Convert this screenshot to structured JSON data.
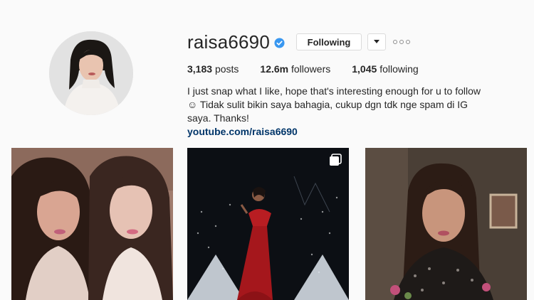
{
  "profile": {
    "username": "raisa6690",
    "follow_label": "Following",
    "stats": {
      "posts_count": "3,183",
      "posts_label": "posts",
      "followers_count": "12.6m",
      "followers_label": "followers",
      "following_count": "1,045",
      "following_label": "following"
    },
    "bio": {
      "text": "I just snap what I like, hope that's interesting enough for u to follow ☺ Tidak sulit bikin saya bahagia, cukup dgn tdk nge spam di IG saya. Thanks!",
      "link": "youtube.com/raisa6690"
    }
  },
  "icons": {
    "verified": "verified-badge-icon",
    "dropdown": "chevron-down-icon",
    "more": "more-options-icon",
    "multi": "multiple-photos-icon"
  },
  "colors": {
    "background": "#fafafa",
    "verified_blue": "#3897f0",
    "link": "#003569",
    "border": "#dbdbdb"
  }
}
